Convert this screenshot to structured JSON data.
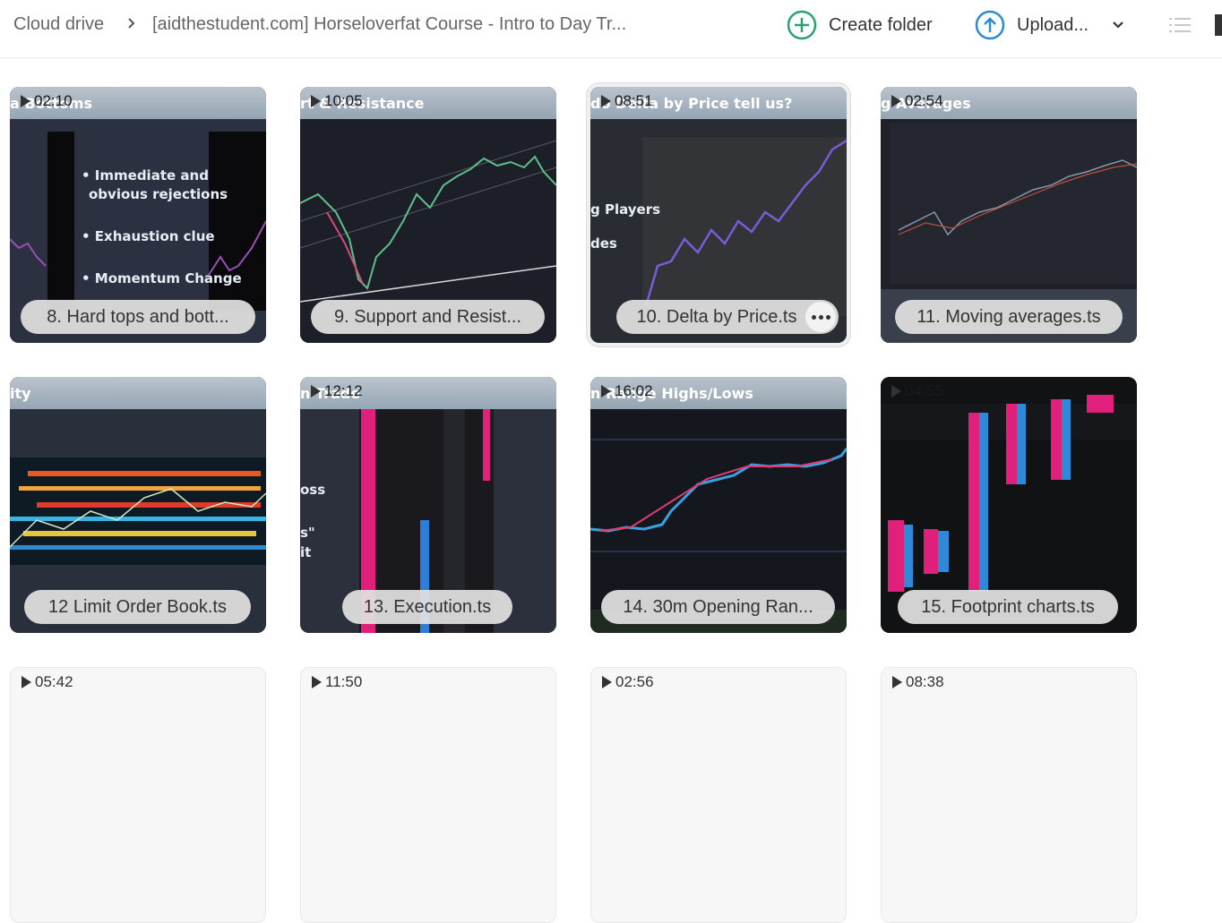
{
  "breadcrumb": {
    "root": "Cloud drive",
    "current": "[aidthestudent.com] Horseloverfat Course - Intro to Day Tr..."
  },
  "toolbar": {
    "create_folder_label": "Create folder",
    "upload_label": "Upload...",
    "create_icon_color": "#2ba26c",
    "upload_icon_color": "#2b8ad8"
  },
  "tiles": [
    {
      "duration": "02:10",
      "name": "8. Hard tops and bott...",
      "strip": "a Bottoms",
      "bullets": [
        "• Immediate and",
        "  obvious rejections",
        "• Exhaustion clue",
        "• Momentum Change"
      ]
    },
    {
      "duration": "10:05",
      "name": "9. Support and Resist...",
      "strip": "rt & Resistance"
    },
    {
      "duration": "08:51",
      "name": "10. Delta by Price.ts",
      "strip": "do Delta by Price tell us?",
      "side": [
        "g Players",
        "des"
      ]
    },
    {
      "duration": "02:54",
      "name": "11. Moving averages.ts",
      "strip": "g Averages"
    },
    {
      "duration": "",
      "name": "12 Limit Order Book.ts",
      "strip": "ity"
    },
    {
      "duration": "12:12",
      "name": "13. Execution.ts",
      "strip": "n Trade",
      "side": [
        "oss",
        "s\"",
        "it"
      ]
    },
    {
      "duration": "16:02",
      "name": "14. 30m Opening Ran...",
      "strip": "n Range Highs/Lows"
    },
    {
      "duration": "04:55",
      "name": "15. Footprint charts.ts",
      "strip": ""
    },
    {
      "duration": "05:42",
      "name": ""
    },
    {
      "duration": "11:50",
      "name": ""
    },
    {
      "duration": "02:56",
      "name": ""
    },
    {
      "duration": "08:38",
      "name": ""
    }
  ]
}
